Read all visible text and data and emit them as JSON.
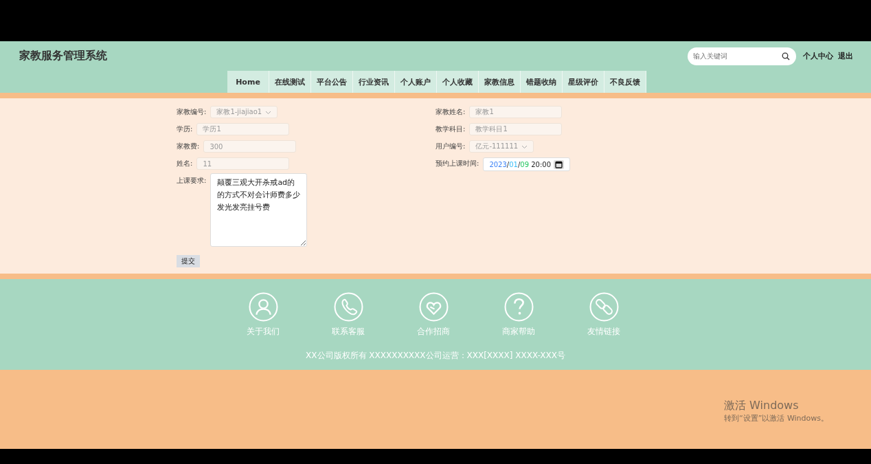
{
  "header": {
    "title": "家教服务管理系统",
    "search": {
      "placeholder": "输入关键词"
    },
    "links": [
      "个人中心",
      "退出"
    ]
  },
  "nav": [
    "Home",
    "在线测试",
    "平台公告",
    "行业资讯",
    "个人账户",
    "个人收藏",
    "家教信息",
    "错题收纳",
    "星级评价",
    "不良反馈"
  ],
  "form": {
    "left": [
      {
        "kind": "select",
        "label": "家教编号:",
        "value": "家教1-jiajiao1",
        "disabled": true
      },
      {
        "kind": "text",
        "label": "学历:",
        "value": "学历1",
        "disabled": true
      },
      {
        "kind": "text",
        "label": "家教费:",
        "value": "300",
        "disabled": true
      },
      {
        "kind": "text",
        "label": "姓名:",
        "value": "11",
        "disabled": true
      },
      {
        "kind": "textarea",
        "label": "上课要求:",
        "value": "颠覆三观大开杀戒ad的的方式不对会计师费多少发光发亮挂号费",
        "disabled": false
      }
    ],
    "right": [
      {
        "kind": "text",
        "label": "家教姓名:",
        "value": "家教1",
        "disabled": true
      },
      {
        "kind": "text",
        "label": "教学科目:",
        "value": "教学科目1",
        "disabled": true
      },
      {
        "kind": "select",
        "label": "用户编号:",
        "value": "亿元-111111",
        "disabled": true
      },
      {
        "kind": "datetime",
        "label": "预约上课时间:",
        "parts": [
          {
            "text": "2023",
            "color": "#3b82f6"
          },
          {
            "text": "/"
          },
          {
            "text": "01",
            "color": "#38bdf8"
          },
          {
            "text": "/"
          },
          {
            "text": "09",
            "color": "#22c55e"
          },
          {
            "text": " 20:00"
          }
        ],
        "disabled": false
      }
    ],
    "submit": "提交"
  },
  "footer": {
    "links": [
      {
        "kind": "person",
        "label": "关于我们"
      },
      {
        "kind": "phone",
        "label": "联系客服"
      },
      {
        "kind": "heart",
        "label": "合作招商"
      },
      {
        "kind": "question",
        "label": "商家帮助"
      },
      {
        "kind": "link",
        "label": "友情链接"
      }
    ],
    "copyright": "XX公司版权所有 XXXXXXXXXX公司运营：XXX[XXXX] XXXX-XXX号"
  },
  "os_notice": {
    "title": "激活 Windows",
    "subtitle": "转到“设置”以激活 Windows。"
  }
}
